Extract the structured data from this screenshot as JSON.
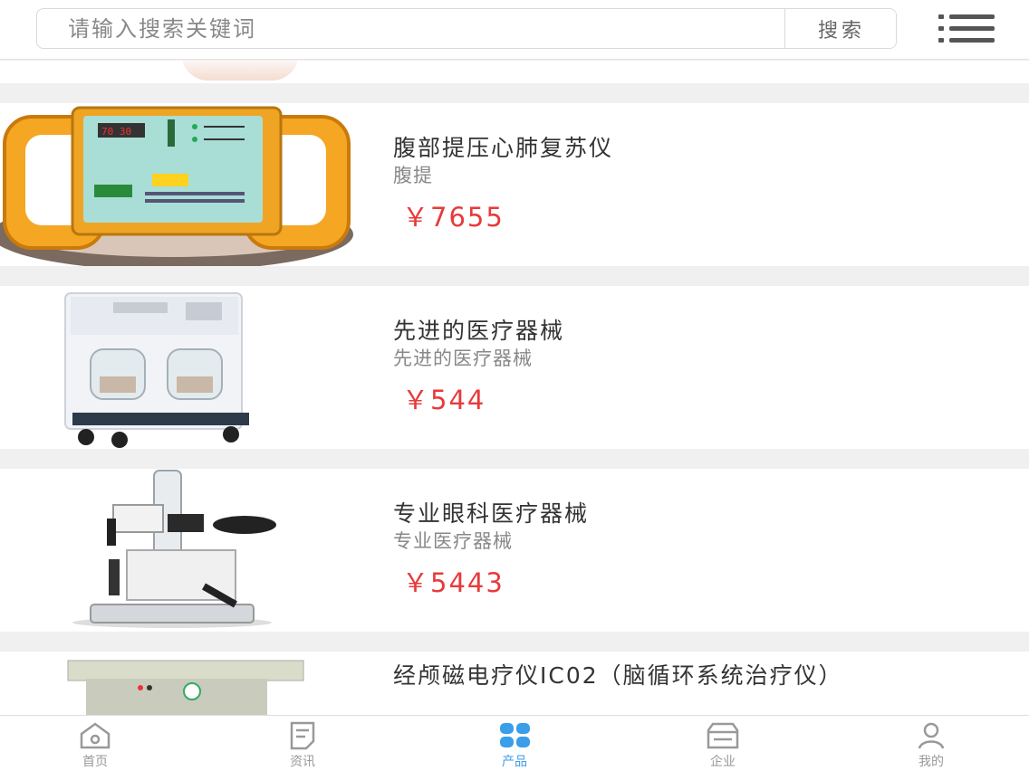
{
  "search": {
    "placeholder": "请输入搜索关键词",
    "button_label": "搜索"
  },
  "products": [
    {
      "name": "腹部提压心肺复苏仪",
      "subtitle": "腹提",
      "price": "￥7655"
    },
    {
      "name": "先进的医疗器械",
      "subtitle": "先进的医疗器械",
      "price": "￥544"
    },
    {
      "name": "专业眼科医疗器械",
      "subtitle": "专业医疗器械",
      "price": "￥5443"
    },
    {
      "name": "经颅磁电疗仪IC02（脑循环系统治疗仪）",
      "subtitle": "",
      "price": ""
    }
  ],
  "nav": {
    "items": [
      {
        "label": "首页",
        "icon": "home-icon",
        "active": false
      },
      {
        "label": "资讯",
        "icon": "news-icon",
        "active": false
      },
      {
        "label": "产品",
        "icon": "products-grid-icon",
        "active": true
      },
      {
        "label": "企业",
        "icon": "company-icon",
        "active": false
      },
      {
        "label": "我的",
        "icon": "user-icon",
        "active": false
      }
    ]
  },
  "colors": {
    "price": "#e83a3a",
    "accent": "#3a9ee8",
    "background": "#f0f0f0"
  }
}
